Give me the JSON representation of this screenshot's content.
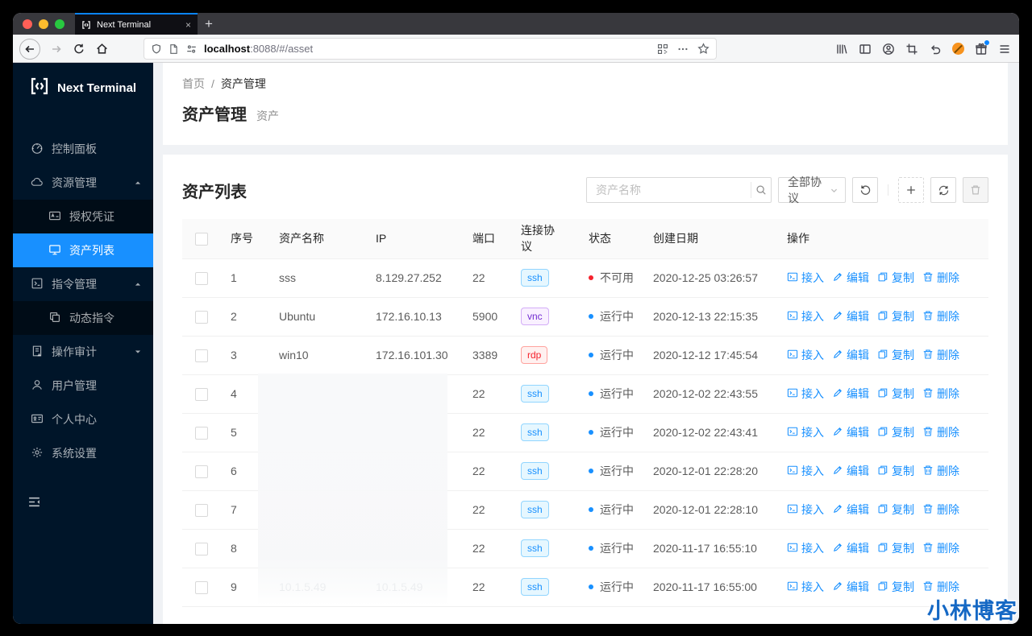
{
  "browser": {
    "tab_title": "Next Terminal",
    "tab_close": "×",
    "new_tab_button": "+",
    "url": {
      "host": "localhost",
      "rest": ":8088/#/asset"
    }
  },
  "sidebar": {
    "logo_text": "Next Terminal",
    "items": [
      {
        "key": "dashboard",
        "label": "控制面板",
        "icon": "dashboard-icon",
        "type": "item"
      },
      {
        "key": "resource-manage",
        "label": "资源管理",
        "icon": "cloud-icon",
        "type": "item",
        "caret": "up"
      },
      {
        "key": "credential",
        "label": "授权凭证",
        "icon": "credential-icon",
        "type": "subitem"
      },
      {
        "key": "asset-list",
        "label": "资产列表",
        "icon": "desktop-icon",
        "type": "subitem",
        "selected": true
      },
      {
        "key": "command-manage",
        "label": "指令管理",
        "icon": "code-icon",
        "type": "item",
        "caret": "up"
      },
      {
        "key": "dynamic-command",
        "label": "动态指令",
        "icon": "block-icon",
        "type": "subitem"
      },
      {
        "key": "audit",
        "label": "操作审计",
        "icon": "audit-icon",
        "type": "item",
        "caret": "down"
      },
      {
        "key": "user-manage",
        "label": "用户管理",
        "icon": "user-icon",
        "type": "item"
      },
      {
        "key": "profile",
        "label": "个人中心",
        "icon": "idcard-icon",
        "type": "item"
      },
      {
        "key": "settings",
        "label": "系统设置",
        "icon": "setting-icon",
        "type": "item"
      }
    ]
  },
  "breadcrumb": {
    "home": "首页",
    "separator": "/",
    "current": "资产管理"
  },
  "page_header": {
    "title": "资产管理",
    "subtitle": "资产"
  },
  "asset_list": {
    "title": "资产列表",
    "search_placeholder": "资产名称",
    "protocol_select": "全部协议",
    "columns": [
      "序号",
      "资产名称",
      "IP",
      "端口",
      "连接协议",
      "状态",
      "创建日期",
      "操作"
    ],
    "action_labels": {
      "access": "接入",
      "edit": "编辑",
      "copy": "复制",
      "delete": "删除"
    },
    "rows": [
      {
        "no": "1",
        "name": "sss",
        "ip": "8.129.27.252",
        "port": "22",
        "protocol": "ssh",
        "status": "不可用",
        "status_type": "error",
        "created": "2020-12-25 03:26:57"
      },
      {
        "no": "2",
        "name": "Ubuntu",
        "ip": "172.16.10.13",
        "port": "5900",
        "protocol": "vnc",
        "status": "运行中",
        "status_type": "running",
        "created": "2020-12-13 22:15:35"
      },
      {
        "no": "3",
        "name": "win10",
        "ip": "172.16.101.30",
        "port": "3389",
        "protocol": "rdp",
        "status": "运行中",
        "status_type": "running",
        "created": "2020-12-12 17:45:54"
      },
      {
        "no": "4",
        "name": "",
        "ip": "",
        "port": "22",
        "protocol": "ssh",
        "status": "运行中",
        "status_type": "running",
        "created": "2020-12-02 22:43:55",
        "redacted": true
      },
      {
        "no": "5",
        "name": "",
        "ip": "",
        "port": "22",
        "protocol": "ssh",
        "status": "运行中",
        "status_type": "running",
        "created": "2020-12-02 22:43:41",
        "redacted": true
      },
      {
        "no": "6",
        "name": "",
        "ip": "",
        "port": "22",
        "protocol": "ssh",
        "status": "运行中",
        "status_type": "running",
        "created": "2020-12-01 22:28:20",
        "redacted": true
      },
      {
        "no": "7",
        "name": "",
        "ip": "",
        "port": "22",
        "protocol": "ssh",
        "status": "运行中",
        "status_type": "running",
        "created": "2020-12-01 22:28:10",
        "redacted": true
      },
      {
        "no": "8",
        "name": "",
        "ip": "",
        "port": "22",
        "protocol": "ssh",
        "status": "运行中",
        "status_type": "running",
        "created": "2020-11-17 16:55:10",
        "redacted": true
      },
      {
        "no": "9",
        "name": "10.1.5.49",
        "ip": "10.1.5.49",
        "port": "22",
        "protocol": "ssh",
        "status": "运行中",
        "status_type": "running",
        "created": "2020-11-17 16:55:00",
        "redacted": true,
        "faint": true
      }
    ]
  },
  "watermark": "小林博客",
  "colors": {
    "accent": "#1890ff",
    "sidebar_bg": "#001529",
    "submenu_bg": "#000c17",
    "selected_bg": "#1890ff",
    "running_dot": "#1890ff",
    "error_dot": "#f5222d",
    "tag_ssh": "#1890ff",
    "tag_vnc": "#722ed1",
    "tag_rdp": "#f5222d",
    "tab_accent": "#0a84ff",
    "watermark_color": "#1568c4"
  }
}
